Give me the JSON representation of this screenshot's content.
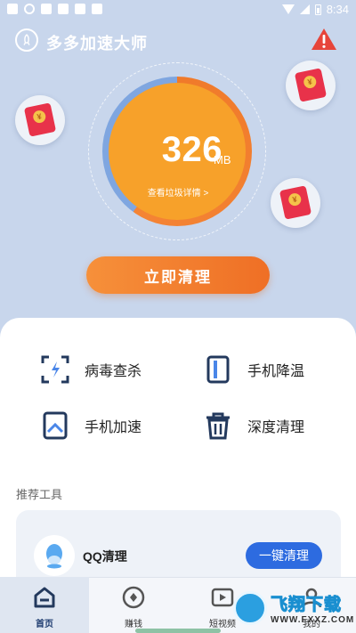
{
  "status_bar": {
    "time": "8:34"
  },
  "header": {
    "app_title": "多多加速大师",
    "logo_icon": "rocket-icon",
    "alert_icon": "warning-triangle-icon"
  },
  "gauge": {
    "value": "326",
    "unit": "MB",
    "link_text": "查看垃圾详情 >",
    "fill_fraction": 0.6
  },
  "envelopes": [
    {
      "icon": "red-envelope-icon",
      "coin": "¥"
    },
    {
      "icon": "red-envelope-icon",
      "coin": "¥"
    },
    {
      "icon": "red-envelope-icon",
      "coin": "¥"
    }
  ],
  "clean_button": {
    "label": "立即清理"
  },
  "tools": {
    "virus": {
      "label": "病毒查杀",
      "icon": "virus-scan-icon"
    },
    "cool": {
      "label": "手机降温",
      "icon": "phone-cool-icon"
    },
    "boost": {
      "label": "手机加速",
      "icon": "phone-boost-icon"
    },
    "deep": {
      "label": "深度清理",
      "icon": "trash-icon"
    }
  },
  "recommend": {
    "section_title": "推荐工具",
    "item": {
      "name": "QQ清理",
      "icon": "qq-icon",
      "button_label": "一键清理"
    }
  },
  "bottom_nav": [
    {
      "label": "首页",
      "icon": "home-icon",
      "active": true
    },
    {
      "label": "赚钱",
      "icon": "coin-icon",
      "active": false
    },
    {
      "label": "短视频",
      "icon": "video-icon",
      "active": false
    },
    {
      "label": "我的",
      "icon": "user-icon",
      "active": false
    }
  ],
  "watermark": {
    "main": "飞翔下载",
    "sub": "WWW.FXXZ.COM"
  },
  "colors": {
    "background": "#c8d6ec",
    "accent_orange": "#f48435",
    "accent_blue": "#2d6be0",
    "danger_red": "#e8324a"
  }
}
